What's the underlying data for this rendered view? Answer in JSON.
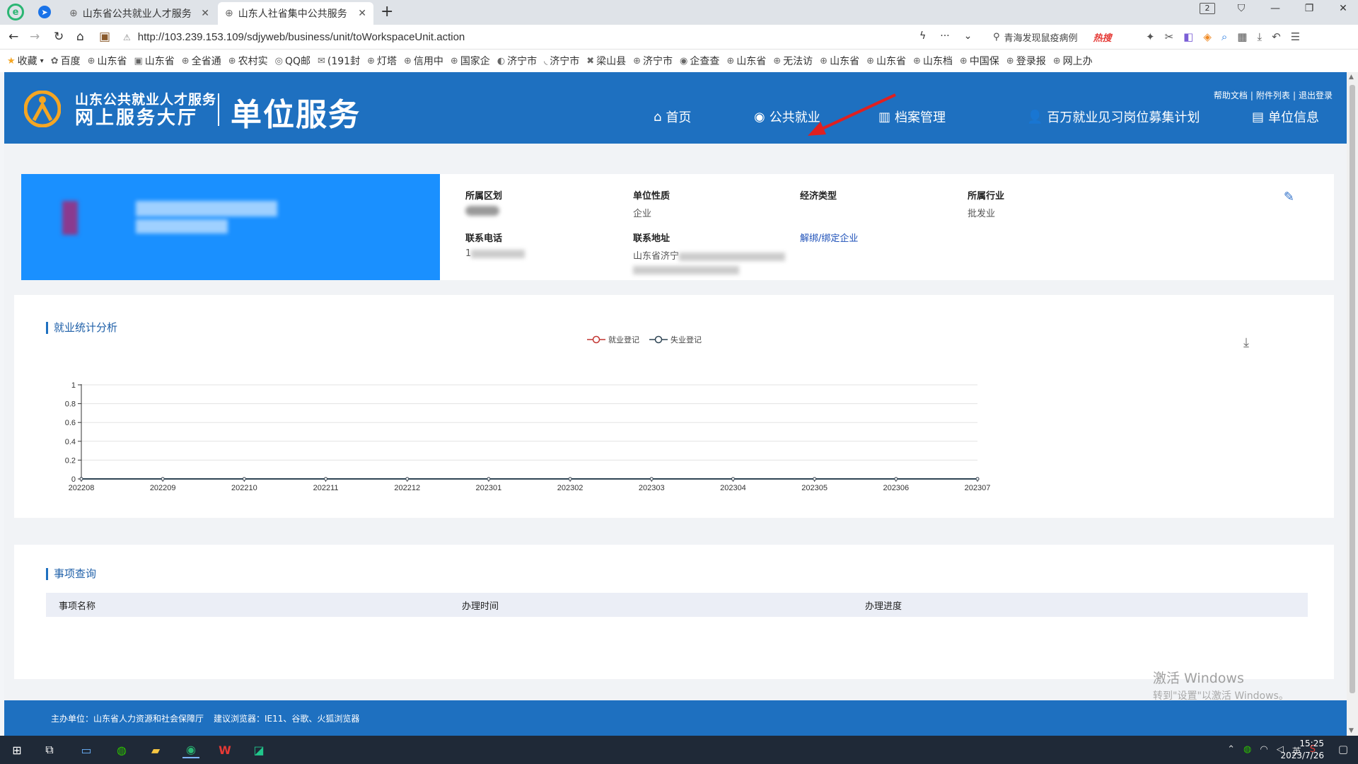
{
  "browser": {
    "tabs": [
      {
        "title": "山东省公共就业人才服务",
        "active": false
      },
      {
        "title": "山东人社省集中公共服务",
        "active": true
      }
    ],
    "new_tab": "+",
    "url": "http://103.239.153.109/sdjyweb/business/unit/toWorkspaceUnit.action",
    "search_suggestion": "青海发现鼠疫病例",
    "hot_label": "热搜",
    "tab_count": "2",
    "bookmarks": [
      "收藏",
      "百度",
      "山东省",
      "山东省",
      "全省通",
      "农村实",
      "QQ邮",
      "(191封",
      "灯塔",
      "信用中",
      "国家企",
      "济宁市",
      "济宁市",
      "梁山县",
      "济宁市",
      "企查查",
      "山东省",
      "无法访",
      "山东省",
      "山东省",
      "山东档",
      "中国保",
      "登录报",
      "网上办"
    ]
  },
  "site": {
    "org_line1": "山东公共就业人才服务",
    "org_line2": "网上服务大厅",
    "section": "单位服务",
    "header_links": [
      "帮助文档",
      "附件列表",
      "退出登录"
    ],
    "nav": [
      {
        "label": "首页",
        "icon": "home-icon"
      },
      {
        "label": "公共就业",
        "icon": "handshake-icon"
      },
      {
        "label": "档案管理",
        "icon": "archive-icon"
      },
      {
        "label": "百万就业见习岗位募集计划",
        "icon": "user-icon"
      },
      {
        "label": "单位信息",
        "icon": "unit-info-icon"
      }
    ]
  },
  "unit_info": {
    "region_label": "所属区划",
    "nature_label": "单位性质",
    "nature_value": "企业",
    "econ_label": "经济类型",
    "industry_label": "所属行业",
    "industry_value": "批发业",
    "phone_label": "联系电话",
    "phone_value": "1",
    "address_label": "联系地址",
    "address_value": "山东省济宁",
    "bind_link": "解绑/绑定企业"
  },
  "stats": {
    "title": "就业统计分析"
  },
  "chart_data": {
    "type": "line",
    "categories": [
      "202208",
      "202209",
      "202210",
      "202211",
      "202212",
      "202301",
      "202302",
      "202303",
      "202304",
      "202305",
      "202306",
      "202307"
    ],
    "series": [
      {
        "name": "就业登记",
        "values": [
          0,
          0,
          0,
          0,
          0,
          0,
          0,
          0,
          0,
          0,
          0,
          0
        ],
        "color": "#c23531"
      },
      {
        "name": "失业登记",
        "values": [
          0,
          0,
          0,
          0,
          0,
          0,
          0,
          0,
          0,
          0,
          0,
          0
        ],
        "color": "#2f4554"
      }
    ],
    "yticks": [
      "0",
      "0.2",
      "0.4",
      "0.6",
      "0.8",
      "1"
    ],
    "ylim": [
      0,
      1
    ],
    "grid": true,
    "legend": "top-center"
  },
  "events": {
    "title": "事项查询",
    "columns": [
      "事项名称",
      "办理时间",
      "办理进度"
    ]
  },
  "watermark": {
    "line1": "激活 Windows",
    "line2": "转到\"设置\"以激活 Windows。"
  },
  "footer": {
    "host": "主办单位：山东省人力资源和社会保障厅",
    "browsers": "建议浏览器：IE11、谷歌、火狐浏览器"
  },
  "taskbar": {
    "ime": "英",
    "time": "15:25",
    "date": "2023/7/26"
  }
}
